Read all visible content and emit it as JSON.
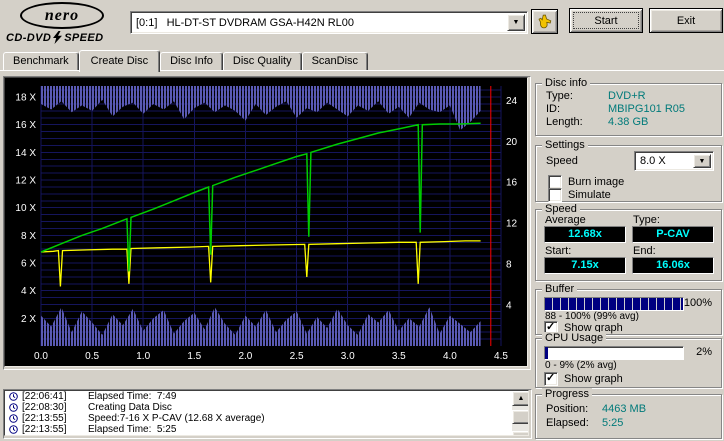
{
  "header": {
    "logo": {
      "name": "nero",
      "product_left": "CD-DVD",
      "product_right": "SPEED"
    },
    "drive_select": "[0:1]   HL-DT-ST DVDRAM GSA-H42N RL00",
    "start_label": "Start",
    "exit_label": "Exit"
  },
  "icons": {
    "dropdown_arrow": "▼",
    "scroll_up": "▲",
    "scroll_down": "▼",
    "checkmark": "✓"
  },
  "tabs": [
    {
      "label": "Benchmark",
      "active": false
    },
    {
      "label": "Create Disc",
      "active": true
    },
    {
      "label": "Disc Info",
      "active": false
    },
    {
      "label": "Disc Quality",
      "active": false
    },
    {
      "label": "ScanDisc",
      "active": false
    }
  ],
  "disc_info": {
    "title": "Disc info",
    "type_label": "Type:",
    "type_value": "DVD+R",
    "id_label": "ID:",
    "id_value": "MBIPG101 R05",
    "length_label": "Length:",
    "length_value": "4.38 GB"
  },
  "settings": {
    "title": "Settings",
    "speed_label": "Speed",
    "speed_value": "8.0 X",
    "burn_image_label": "Burn image",
    "burn_image_checked": false,
    "simulate_label": "Simulate",
    "simulate_checked": false
  },
  "speed_panel": {
    "title": "Speed",
    "average_label": "Average",
    "average_value": "12.68x",
    "type_label": "Type:",
    "type_value": "P-CAV",
    "start_label": "Start:",
    "start_value": "7.15x",
    "end_label": "End:",
    "end_value": "16.06x"
  },
  "buffer": {
    "title": "Buffer",
    "percent": "100%",
    "fill_percent": 100,
    "range_text": "88 - 100% (99% avg)",
    "show_graph_label": "Show graph",
    "show_graph_checked": true
  },
  "cpu": {
    "title": "CPU Usage",
    "percent": "2%",
    "fill_percent": 2,
    "range_text": "0 - 9% (2% avg)",
    "show_graph_label": "Show graph",
    "show_graph_checked": true
  },
  "progress": {
    "title": "Progress",
    "position_label": "Position:",
    "position_value": "4463 MB",
    "elapsed_label": "Elapsed:",
    "elapsed_value": "5:25"
  },
  "log": {
    "rows": [
      {
        "time": "[22:06:41]",
        "text": "Elapsed Time:  7:49"
      },
      {
        "time": "[22:08:30]",
        "text": "Creating Data Disc"
      },
      {
        "time": "[22:13:55]",
        "text": "Speed:7-16 X P-CAV (12.68 X average)"
      },
      {
        "time": "[22:13:55]",
        "text": "Elapsed Time:  5:25"
      }
    ]
  },
  "colors": {
    "window_gray": "#d4d0c8",
    "value_cyan": "#00ffff",
    "info_teal": "#007a7a",
    "progress_navy": "#000080"
  },
  "chart_data": {
    "type": "line",
    "x_range": [
      0,
      4.5
    ],
    "y_left_range": [
      0,
      18.8
    ],
    "y_right_range": [
      0,
      25.4
    ],
    "x_ticks": [
      0,
      0.5,
      1,
      1.5,
      2,
      2.5,
      3,
      3.5,
      4,
      4.5
    ],
    "y_left_ticks": [
      2,
      4,
      6,
      8,
      10,
      12,
      14,
      16,
      18
    ],
    "y_left_suffix": " X",
    "y_right_ticks": [
      4,
      8,
      12,
      16,
      20,
      24
    ],
    "grid": true,
    "grid_color": "#15155c",
    "grid_step_y": 0.5,
    "bg_color": "#000000",
    "band_color": "#5a5ab4",
    "cursor": {
      "x": 4.4,
      "color": "#ff0000"
    },
    "series": [
      {
        "name": "secondary-speed-yellow",
        "color": "#ffff00",
        "width": 1.3,
        "points": [
          [
            0,
            6.8
          ],
          [
            0.12,
            6.85
          ],
          [
            0.17,
            6.9
          ],
          [
            0.19,
            4.3
          ],
          [
            0.21,
            6.9
          ],
          [
            0.45,
            6.95
          ],
          [
            0.7,
            7.0
          ],
          [
            0.84,
            7.0
          ],
          [
            0.86,
            4.5
          ],
          [
            0.88,
            7.05
          ],
          [
            1.15,
            7.1
          ],
          [
            1.45,
            7.15
          ],
          [
            1.64,
            7.2
          ],
          [
            1.66,
            4.6
          ],
          [
            1.68,
            7.2
          ],
          [
            1.95,
            7.25
          ],
          [
            2.25,
            7.3
          ],
          [
            2.58,
            7.35
          ],
          [
            2.6,
            5.0
          ],
          [
            2.62,
            7.35
          ],
          [
            2.9,
            7.4
          ],
          [
            3.2,
            7.45
          ],
          [
            3.5,
            7.5
          ],
          [
            3.67,
            7.5
          ],
          [
            3.69,
            4.5
          ],
          [
            3.71,
            7.5
          ],
          [
            3.95,
            7.55
          ],
          [
            4.15,
            7.6
          ],
          [
            4.3,
            7.6
          ]
        ]
      },
      {
        "name": "write-speed-green",
        "color": "#00cc00",
        "width": 1.5,
        "points": [
          [
            0,
            6.8
          ],
          [
            0.2,
            7.4
          ],
          [
            0.4,
            8.0
          ],
          [
            0.6,
            8.5
          ],
          [
            0.84,
            9.2
          ],
          [
            0.86,
            5.4
          ],
          [
            0.88,
            9.3
          ],
          [
            1.1,
            9.9
          ],
          [
            1.3,
            10.5
          ],
          [
            1.5,
            11.1
          ],
          [
            1.64,
            11.5
          ],
          [
            1.66,
            6.6
          ],
          [
            1.68,
            11.6
          ],
          [
            1.9,
            12.2
          ],
          [
            2.1,
            12.7
          ],
          [
            2.3,
            13.2
          ],
          [
            2.5,
            13.7
          ],
          [
            2.6,
            13.9
          ],
          [
            2.62,
            7.9
          ],
          [
            2.64,
            14.0
          ],
          [
            2.9,
            14.6
          ],
          [
            3.1,
            15.0
          ],
          [
            3.3,
            15.4
          ],
          [
            3.5,
            15.7
          ],
          [
            3.66,
            15.95
          ],
          [
            3.69,
            16.0
          ],
          [
            3.71,
            8.2
          ],
          [
            3.73,
            16.0
          ],
          [
            3.9,
            16.05
          ],
          [
            4.1,
            16.05
          ],
          [
            4.3,
            16.1
          ]
        ]
      }
    ],
    "buffer_band": {
      "name": "buffer-level-band",
      "x_start": 0,
      "x_step": 0.1,
      "values": [
        17.5,
        17.1,
        17.7,
        16.9,
        17.4,
        17.0,
        17.8,
        16.6,
        17.3,
        17.6,
        16.8,
        17.5,
        17.1,
        17.7,
        16.4,
        17.2,
        17.6,
        16.9,
        17.4,
        17.0,
        16.3,
        17.5,
        16.7,
        17.3,
        17.7,
        16.5,
        17.2,
        16.9,
        17.6,
        17.1,
        16.6,
        17.4,
        17.0,
        17.7,
        16.8,
        17.3,
        16.5,
        17.6,
        17.1,
        16.9,
        17.4,
        15.6,
        16.2,
        17.0
      ]
    },
    "cpu_band": {
      "name": "cpu-usage-band",
      "x_start": 0,
      "x_step": 0.1,
      "values": [
        2.2,
        1.4,
        2.8,
        1.0,
        2.5,
        1.7,
        0.8,
        2.3,
        1.5,
        2.7,
        1.1,
        2.0,
        2.6,
        0.9,
        1.8,
        2.4,
        1.2,
        2.8,
        1.6,
        0.8,
        2.2,
        1.4,
        2.6,
        1.0,
        1.9,
        2.5,
        0.9,
        2.1,
        1.3,
        2.7,
        1.5,
        0.8,
        2.3,
        1.7,
        2.6,
        1.1,
        2.0,
        1.4,
        2.8,
        0.9,
        2.2,
        1.6,
        1.0,
        1.8
      ]
    }
  }
}
